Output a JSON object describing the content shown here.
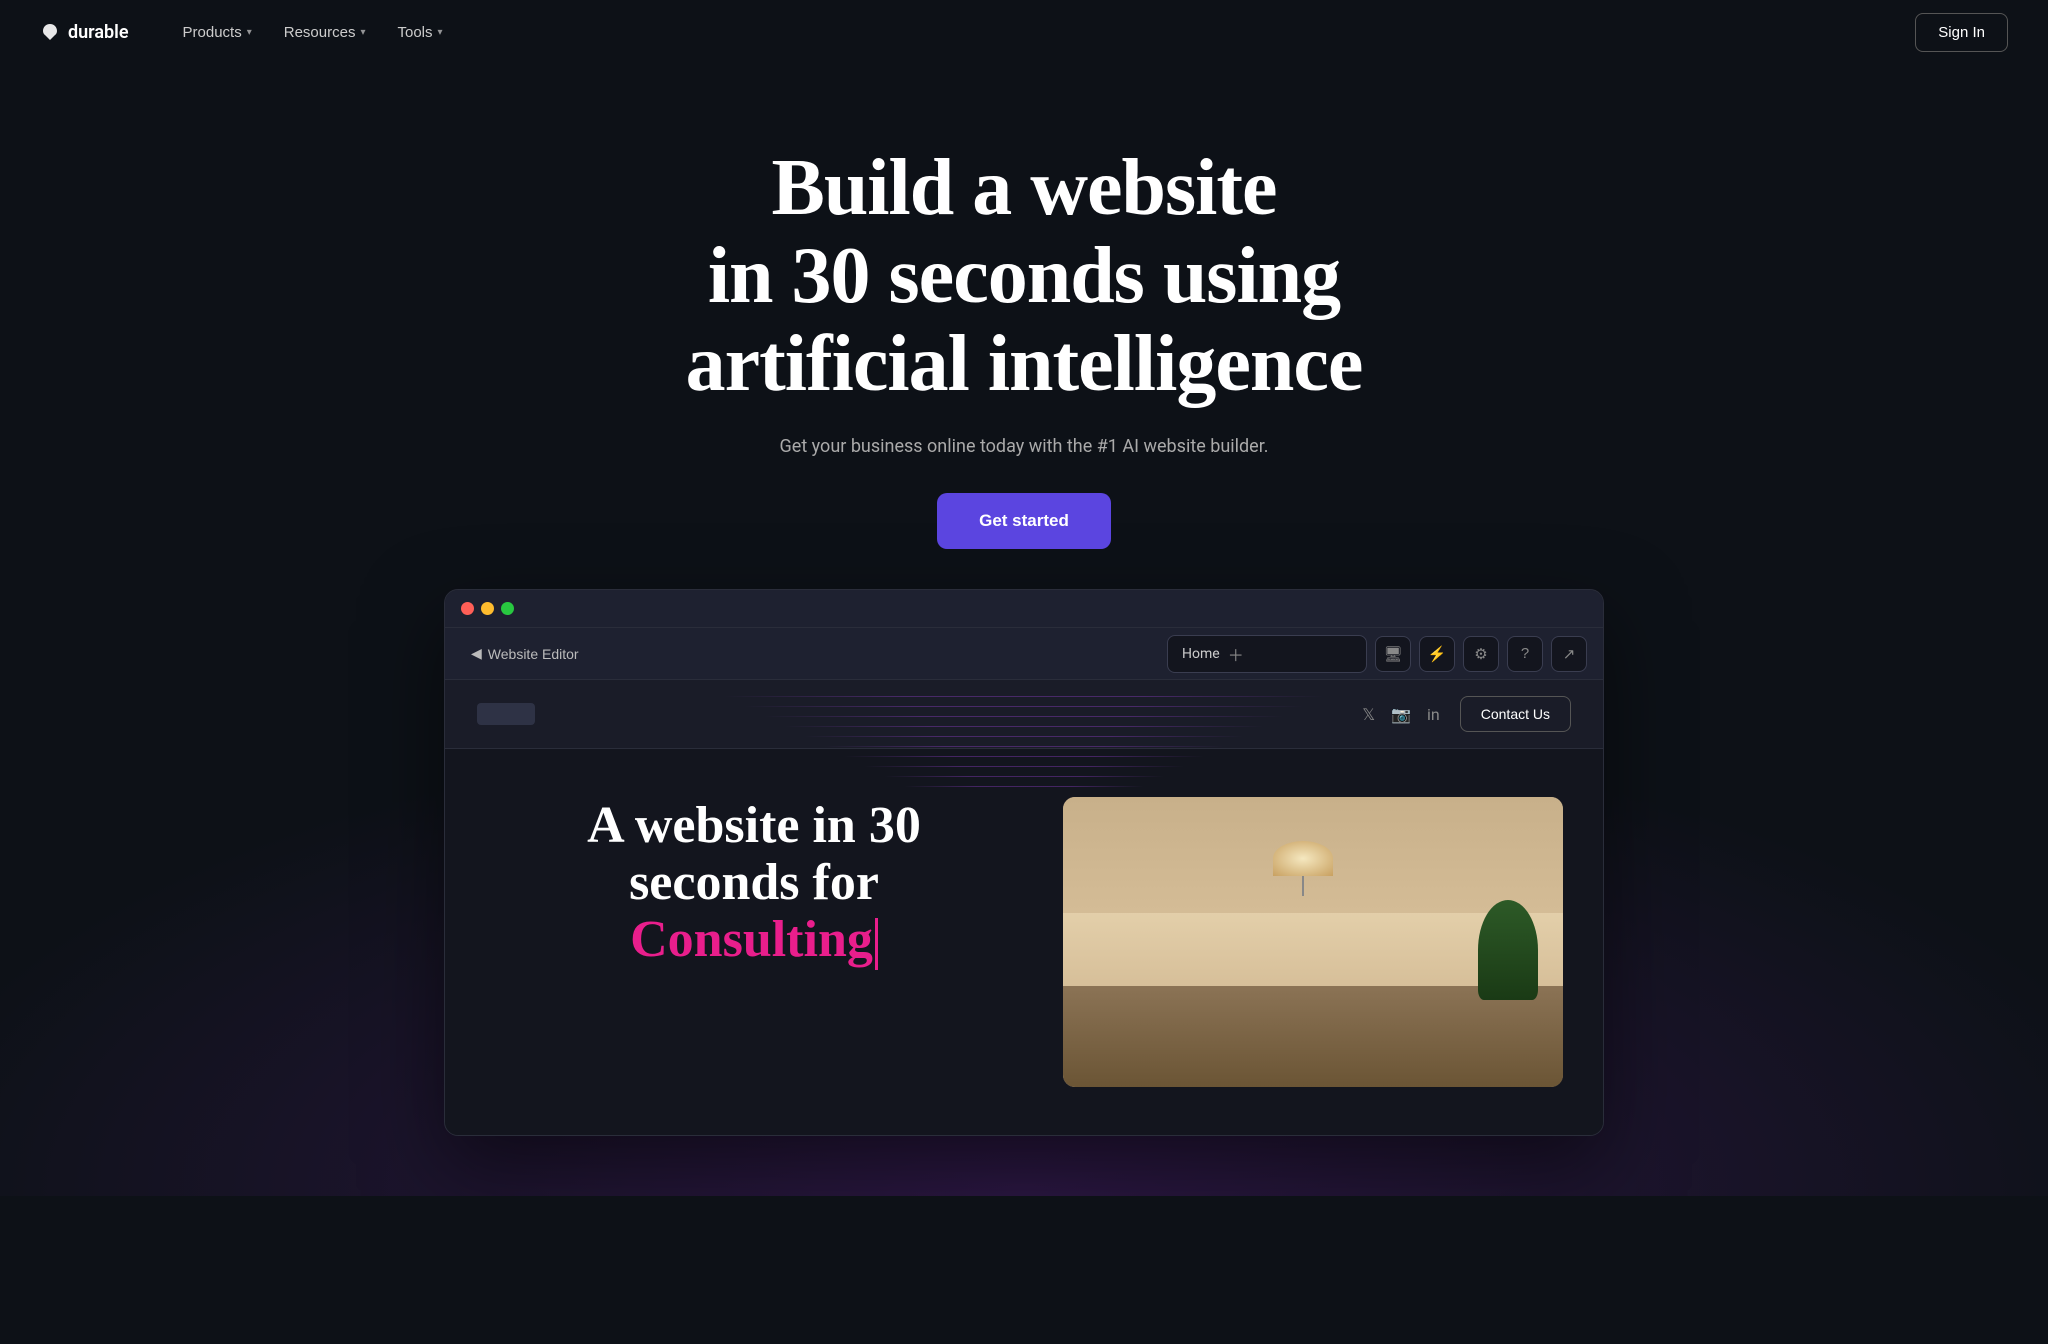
{
  "nav": {
    "logo_text": "durable",
    "items": [
      {
        "label": "Products",
        "has_dropdown": true
      },
      {
        "label": "Resources",
        "has_dropdown": true
      },
      {
        "label": "Tools",
        "has_dropdown": true
      }
    ],
    "sign_in_label": "Sign In"
  },
  "hero": {
    "headline_line1": "Build a website",
    "headline_line2": "in 30 seconds using",
    "headline_line3": "artificial intelligence",
    "subheadline": "Get your business online today with the #1 AI website builder.",
    "cta_label": "Get started"
  },
  "editor": {
    "back_label": "Website Editor",
    "url_bar_text": "Home",
    "toolbar_icons": [
      "monitor",
      "lightning",
      "gear",
      "help",
      "external"
    ]
  },
  "preview": {
    "contact_us_label": "Contact Us",
    "heading_line1": "A website in 30",
    "heading_line2": "seconds for",
    "heading_accent": "Consulting",
    "social_icons": [
      "twitter",
      "instagram",
      "linkedin"
    ]
  }
}
